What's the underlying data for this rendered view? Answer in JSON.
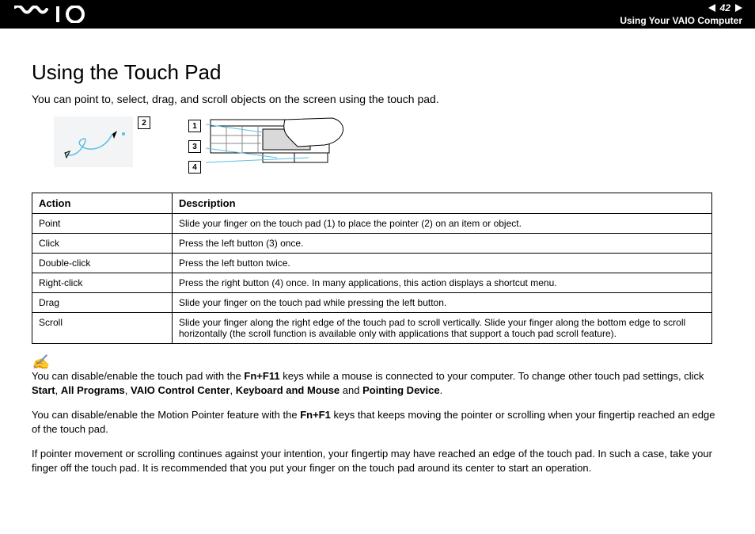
{
  "header": {
    "page_number": "42",
    "section_label": "Using Your VAIO Computer"
  },
  "title": "Using the Touch Pad",
  "intro": "You can point to, select, drag, and scroll objects on the screen using the touch pad.",
  "callouts": {
    "c1": "1",
    "c2": "2",
    "c3": "3",
    "c4": "4"
  },
  "table": {
    "head_action": "Action",
    "head_desc": "Description",
    "rows": [
      {
        "action": "Point",
        "desc": "Slide your finger on the touch pad (1) to place the pointer (2) on an item or object."
      },
      {
        "action": "Click",
        "desc": "Press the left button (3) once."
      },
      {
        "action": "Double-click",
        "desc": "Press the left button twice."
      },
      {
        "action": "Right-click",
        "desc": "Press the right button (4) once. In many applications, this action displays a shortcut menu."
      },
      {
        "action": "Drag",
        "desc": "Slide your finger on the touch pad while pressing the left button."
      },
      {
        "action": "Scroll",
        "desc": "Slide your finger along the right edge of the touch pad to scroll vertically. Slide your finger along the bottom edge to scroll horizontally (the scroll function is available only with applications that support a touch pad scroll feature)."
      }
    ]
  },
  "notes": {
    "n1a": "You can disable/enable the touch pad with the ",
    "n1b": "Fn+F11",
    "n1c": " keys while a mouse is connected to your computer. To change other touch pad settings, click ",
    "n1d": "Start",
    "n1e": ", ",
    "n1f": "All Programs",
    "n1g": ", ",
    "n1h": "VAIO Control Center",
    "n1i": ", ",
    "n1j": "Keyboard and Mouse",
    "n1k": " and ",
    "n1l": "Pointing Device",
    "n1m": ".",
    "n2a": "You can disable/enable the Motion Pointer feature with the ",
    "n2b": "Fn+F1",
    "n2c": " keys that keeps moving the pointer or scrolling when your fingertip reached an edge of the touch pad.",
    "n3": "If pointer movement or scrolling continues against your intention, your fingertip may have reached an edge of the touch pad. In such a case, take your finger off the touch pad. It is recommended that you put your finger on the touch pad around its center to start an operation."
  }
}
